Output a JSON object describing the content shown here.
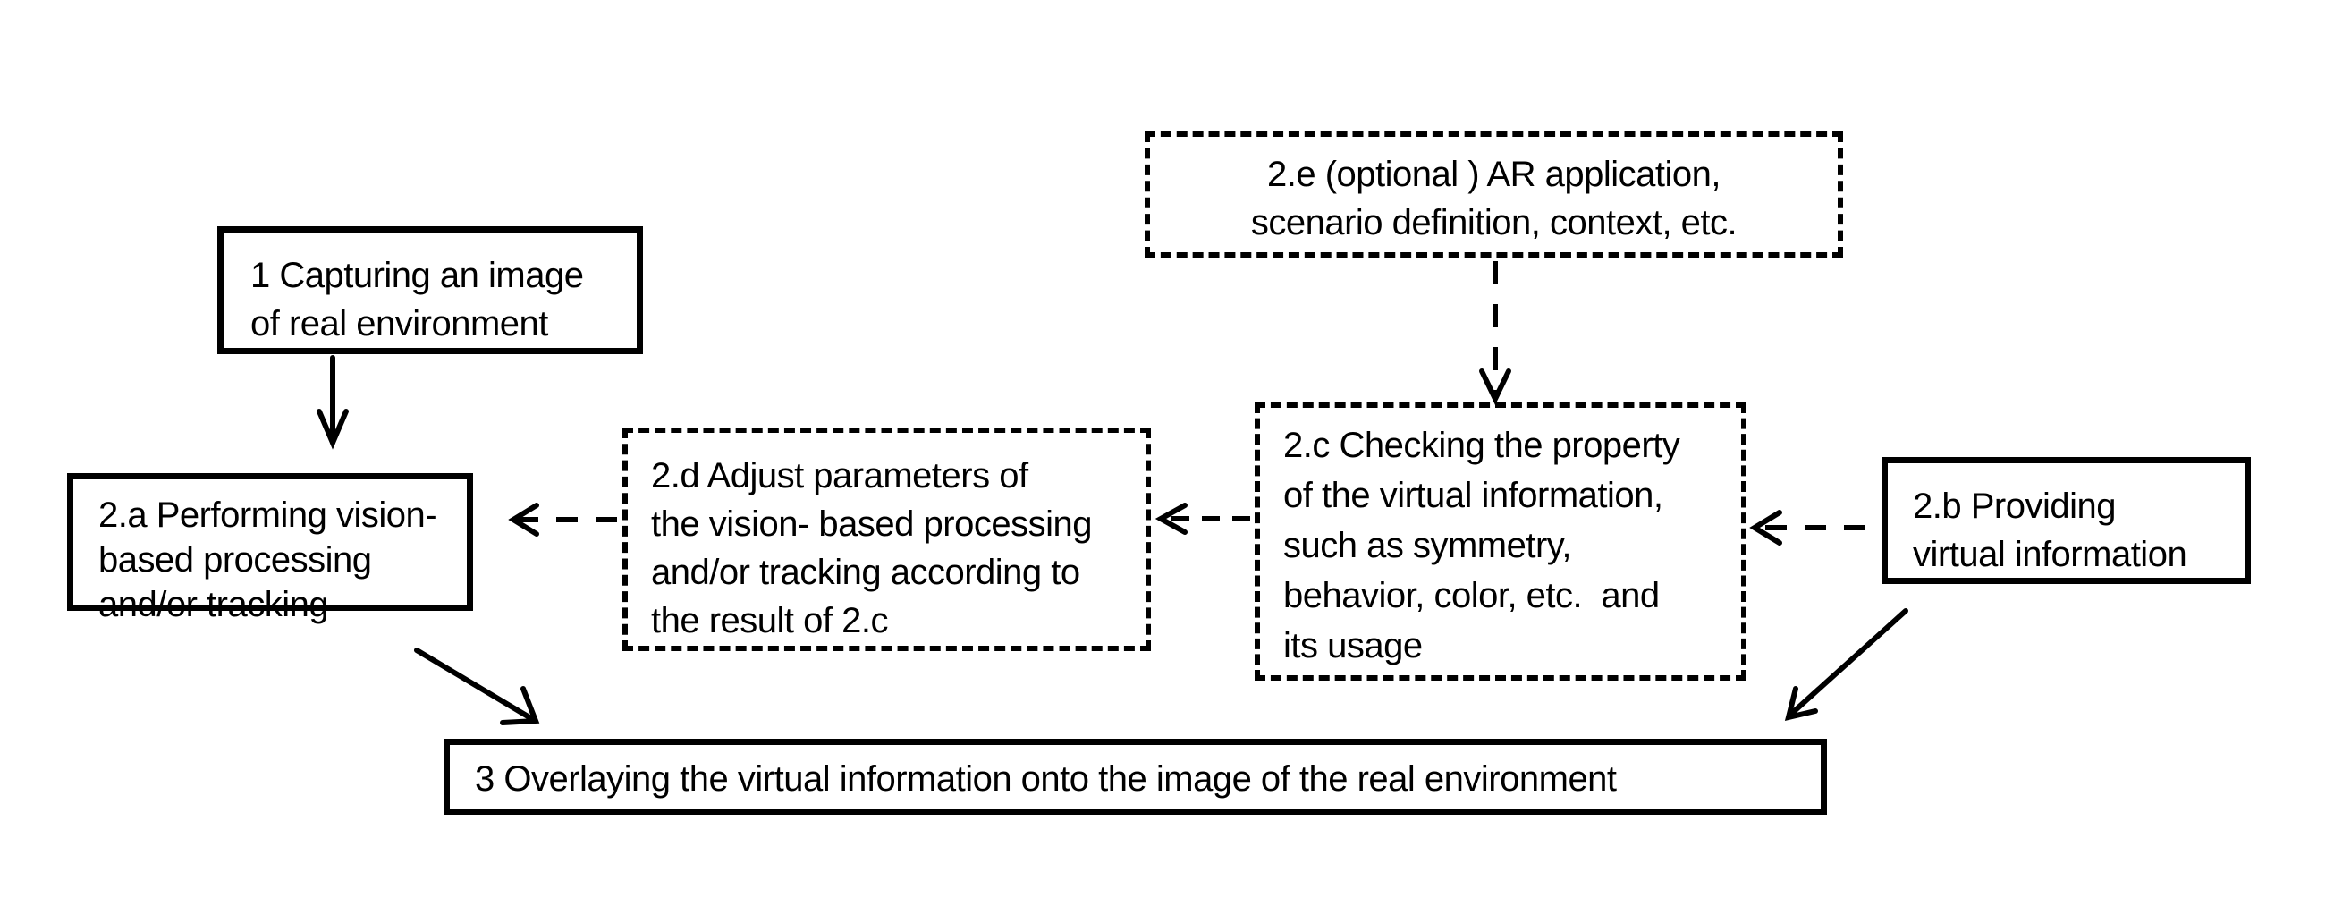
{
  "diagram": {
    "nodes": {
      "n1": {
        "id": "1",
        "style": "solid",
        "lines": [
          "1 Capturing an image",
          "of real environment"
        ]
      },
      "n2a": {
        "id": "2.a",
        "style": "solid",
        "lines": [
          "2.a Performing vision-",
          "based processing",
          "and/or tracking"
        ]
      },
      "n2b": {
        "id": "2.b",
        "style": "solid",
        "lines": [
          "2.b Providing",
          "virtual information"
        ]
      },
      "n2c": {
        "id": "2.c",
        "style": "dashed",
        "lines": [
          "2.c Checking the property",
          "of the virtual information,",
          "such as symmetry,",
          "behavior, color, etc.  and",
          "its usage"
        ]
      },
      "n2d": {
        "id": "2.d",
        "style": "dashed",
        "lines": [
          "2.d Adjust parameters of",
          "the vision- based processing",
          "and/or tracking according to",
          "the result of 2.c"
        ]
      },
      "n2e": {
        "id": "2.e",
        "style": "dashed",
        "lines": [
          "2.e (optional ) AR application,",
          "scenario definition, context, etc."
        ]
      },
      "n3": {
        "id": "3",
        "style": "solid",
        "lines": [
          "3 Overlaying the virtual information onto the image of the real environment"
        ]
      }
    },
    "edges": [
      {
        "from": "1",
        "to": "2.a",
        "style": "solid"
      },
      {
        "from": "2.e",
        "to": "2.c",
        "style": "dashed"
      },
      {
        "from": "2.c",
        "to": "2.d",
        "style": "dashed"
      },
      {
        "from": "2.d",
        "to": "2.a",
        "style": "dashed"
      },
      {
        "from": "2.b",
        "to": "2.c",
        "style": "dashed"
      },
      {
        "from": "2.a",
        "to": "3",
        "style": "solid"
      },
      {
        "from": "2.b",
        "to": "3",
        "style": "solid"
      }
    ]
  }
}
